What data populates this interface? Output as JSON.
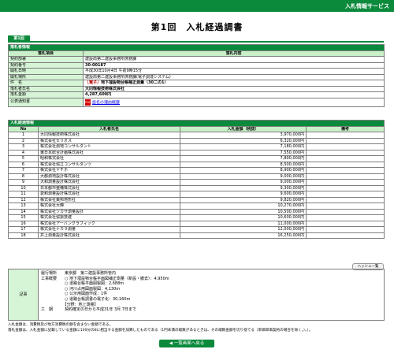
{
  "header": {
    "service": "入札情報サービス",
    "title": "第1回　入札経過調書",
    "tab": "第1回"
  },
  "rakusatsu": {
    "section_title": "落札者情報",
    "col_item": "落札項目",
    "col_content": "落札内容",
    "rows": [
      {
        "label": "契約部署",
        "value": "建設局第二建設事務所庶務課"
      },
      {
        "label": "契約番号",
        "value": "30-00187"
      },
      {
        "label": "開札日時",
        "value": "平成30年10月4日 午前9時15分"
      },
      {
        "label": "開札場所",
        "value": "建設局第二建設事務所庶務課(電子調達システム)"
      },
      {
        "label": "件　名",
        "value": "地下埋設物台帳補正測量（30二の1）",
        "prefix": "［電子］"
      },
      {
        "label": "落札者氏名",
        "value": "大同情報技術株式会社"
      },
      {
        "label": "落札金額",
        "value": "4,287,600円"
      },
      {
        "label": "公表通知書",
        "value": "設名の理由概要"
      }
    ]
  },
  "keika": {
    "section_title": "入札経過情報",
    "col_no": "No",
    "col_name": "入札者氏名",
    "col_amount": "入札金額（税抜）",
    "col_note": "備考",
    "rows": [
      {
        "no": "1",
        "name": "大同情報技術株式会社",
        "amount": "3,970,000円",
        "note": ""
      },
      {
        "no": "2",
        "name": "株式会社セリオス",
        "amount": "6,320,000円",
        "note": ""
      },
      {
        "no": "3",
        "name": "株式会社測地コンサルタント",
        "amount": "7,180,000円",
        "note": ""
      },
      {
        "no": "4",
        "name": "東日本総合計画株式会社",
        "amount": "7,550,000円",
        "note": ""
      },
      {
        "no": "5",
        "name": "昭和株式会社",
        "amount": "7,800,000円",
        "note": ""
      },
      {
        "no": "6",
        "name": "株式会社協立コンサルタンツ",
        "amount": "8,500,000円",
        "note": ""
      },
      {
        "no": "7",
        "name": "株式会社ヤチホ",
        "amount": "8,900,000円",
        "note": ""
      },
      {
        "no": "8",
        "name": "大都測地設計株式会社",
        "amount": "9,000,000円",
        "note": ""
      },
      {
        "no": "9",
        "name": "大和測量設計株式会社",
        "amount": "9,000,000円",
        "note": ""
      },
      {
        "no": "10",
        "name": "日本都市整備株式会社",
        "amount": "9,300,000円",
        "note": ""
      },
      {
        "no": "11",
        "name": "愛和測量設計株式会社",
        "amount": "9,600,000円",
        "note": ""
      },
      {
        "no": "12",
        "name": "株式会社東邦地形社",
        "amount": "9,820,000円",
        "note": ""
      },
      {
        "no": "13",
        "name": "株式会社大輝",
        "amount": "10,270,000円",
        "note": ""
      },
      {
        "no": "14",
        "name": "株式会社ツカサ測量設計",
        "amount": "10,500,000円",
        "note": ""
      },
      {
        "no": "15",
        "name": "株式会社協振技建",
        "amount": "10,600,000円",
        "note": ""
      },
      {
        "no": "16",
        "name": "株式会社アーバングラフィック",
        "amount": "11,000,000円",
        "note": ""
      },
      {
        "no": "17",
        "name": "株式会社ナカラ測量",
        "amount": "12,000,000円",
        "note": ""
      },
      {
        "no": "18",
        "name": "井上測量設計株式会社",
        "amount": "16,250,000円",
        "note": ""
      }
    ]
  },
  "kiji": {
    "list_button": "ハッシュ一覧",
    "label": "記事",
    "text": "履行場所　　東京都　第二建設事務所管内\n工事概要　　○ 地下埋設物台帳平面図補正測量（新設・撤去）：4,950m\n　　　　　　○ 道路台帳平面図製図：2,688m\n　　　　　　○ 河川占用図面製図：4,130m\n　　　　　　○ 公示用図面作成：1件\n　　　　　　○ 道路台帳調書の電子化：30,160m\n　　　　　　【分野：地上測量】\n工　期　　　契約確定の日から平成31年 3月 7日まで"
  },
  "notes": {
    "line1": "入札金額は、消費税及び地方消費税の額を含まない金額である。",
    "line2": "落札金額は、入札金額に記載している金額に100分の8に相当する金額を加算したものである（1円未満の端数があるときは、その端数金額を切り捨てる（単価単価契約の場合を除く。）。）。"
  },
  "footer": {
    "back_button": "◀ 一覧画面へ戻る"
  },
  "colors": {
    "brand_green": "#0b8a3c",
    "label_bg": "#d6f5d6",
    "header_bg": "#c9f0c9"
  }
}
